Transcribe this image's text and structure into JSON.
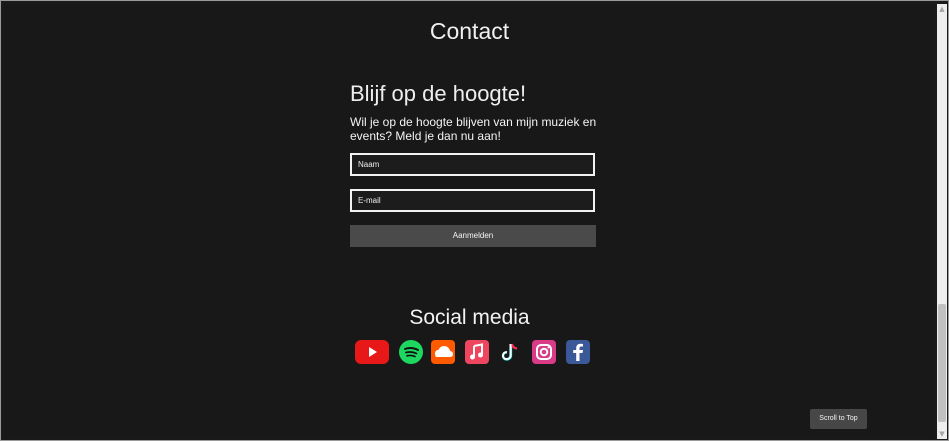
{
  "header": {
    "contact_title": "Contact"
  },
  "newsletter": {
    "title": "Blijf op de hoogte!",
    "description": "Wil je op de hoogte blijven van mijn muziek en events? Meld je dan nu aan!",
    "name_placeholder": "Naam",
    "email_placeholder": "E-mail",
    "submit_label": "Aanmelden"
  },
  "social": {
    "title": "Social media",
    "icons": [
      "youtube-icon",
      "spotify-icon",
      "soundcloud-icon",
      "music-icon",
      "tiktok-icon",
      "instagram-icon",
      "facebook-icon"
    ]
  },
  "footer": {
    "scroll_to_top_label": "Scroll to Top"
  },
  "colors": {
    "background": "#181818",
    "input_border": "#f2f2f2",
    "button": "#4a4a4a",
    "youtube": "#e81818",
    "spotify": "#1ed760",
    "soundcloud": "#ff5a00",
    "music": "#ef4660",
    "instagram": "#d83b88",
    "facebook": "#3b5998"
  }
}
